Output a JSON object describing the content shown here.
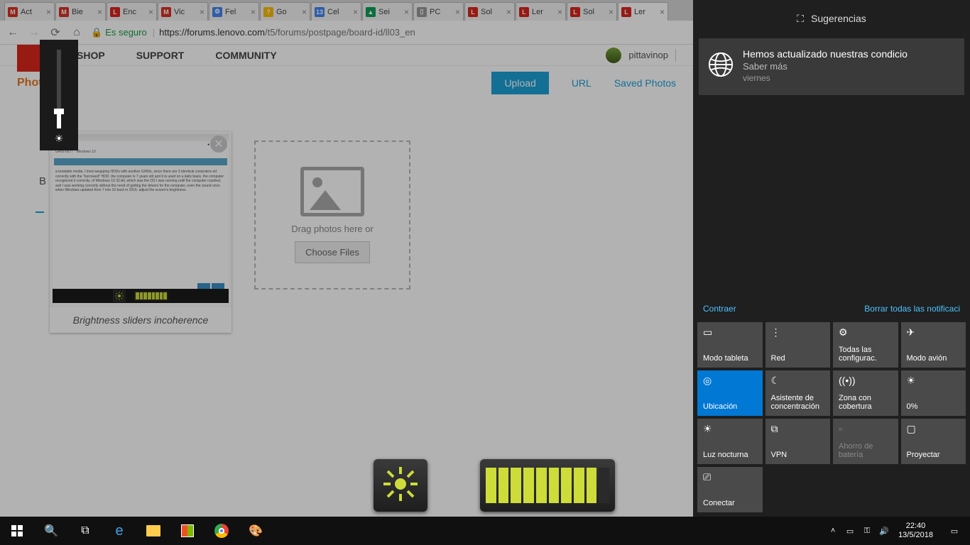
{
  "browser": {
    "tabs": [
      {
        "label": "Act",
        "fav": "M",
        "favbg": "#d93025"
      },
      {
        "label": "Bie",
        "fav": "M",
        "favbg": "#d93025"
      },
      {
        "label": "Enc",
        "fav": "L",
        "favbg": "#d9261c"
      },
      {
        "label": "Vic",
        "fav": "M",
        "favbg": "#d93025"
      },
      {
        "label": "Fel",
        "fav": "⚙",
        "favbg": "#4285f4"
      },
      {
        "label": "Go",
        "fav": "?",
        "favbg": "#fbbc04"
      },
      {
        "label": "Cel",
        "fav": "13",
        "favbg": "#4285f4"
      },
      {
        "label": "Sei",
        "fav": "▲",
        "favbg": "#0f9d58"
      },
      {
        "label": "PC",
        "fav": "▯",
        "favbg": "#999"
      },
      {
        "label": "Sol",
        "fav": "L",
        "favbg": "#d9261c"
      },
      {
        "label": "Ler",
        "fav": "L",
        "favbg": "#d9261c"
      },
      {
        "label": "Sol",
        "fav": "L",
        "favbg": "#d9261c"
      },
      {
        "label": "Ler",
        "fav": "L",
        "favbg": "#d9261c"
      }
    ],
    "secure_label": "Es seguro",
    "url_host": "https://forums.lenovo.com",
    "url_path": "/t5/forums/postpage/board-id/ll03_en"
  },
  "site": {
    "nav": {
      "shop": "SHOP",
      "support": "SUPPORT",
      "community": "COMMUNITY"
    },
    "username": "pittavinop"
  },
  "photos": {
    "title": "Photos",
    "upload": "Upload",
    "url": "URL",
    "saved": "Saved Photos",
    "drag_text": "Drag photos here or",
    "choose": "Choose Files",
    "thumb_caption": "Brightness sliders incoherence",
    "letter": "B"
  },
  "action_center": {
    "header": "Sugerencias",
    "notif_title": "Hemos actualizado nuestras condicio",
    "notif_sub": "Saber más",
    "notif_time": "viernes",
    "collapse": "Contraer",
    "clear": "Borrar todas las notificaci",
    "tiles": [
      {
        "label": "Modo tableta",
        "icon": "▭",
        "on": false
      },
      {
        "label": "Red",
        "icon": "⋮",
        "on": false
      },
      {
        "label": "Todas las configurac.",
        "icon": "⚙",
        "on": false
      },
      {
        "label": "Modo avión",
        "icon": "✈",
        "on": false
      },
      {
        "label": "Ubicación",
        "icon": "◎",
        "on": true
      },
      {
        "label": "Asistente de concentración",
        "icon": "☾",
        "on": false
      },
      {
        "label": "Zona con cobertura",
        "icon": "((•))",
        "on": false
      },
      {
        "label": "0%",
        "icon": "☀",
        "on": false
      },
      {
        "label": "Luz nocturna",
        "icon": "☀",
        "on": false
      },
      {
        "label": "VPN",
        "icon": "⧉",
        "on": false
      },
      {
        "label": "Ahorro de batería",
        "icon": "▫",
        "on": false,
        "disabled": true
      },
      {
        "label": "Proyectar",
        "icon": "▢",
        "on": false
      },
      {
        "label": "Conectar",
        "icon": "⎚",
        "on": false
      }
    ]
  },
  "taskbar": {
    "time": "22:40",
    "date": "13/5/2018"
  }
}
